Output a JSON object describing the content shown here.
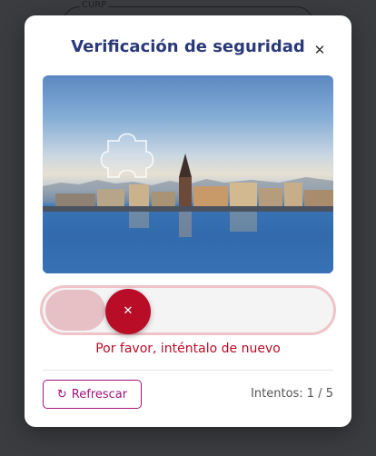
{
  "background": {
    "field_label": "CURP"
  },
  "captcha": {
    "title": "Verificación de seguridad",
    "close_icon": "close-icon",
    "slider_handle_icon": "close-icon",
    "error_message": "Por favor, inténtalo de nuevo",
    "refresh_label": "Refrescar",
    "refresh_icon": "refresh-icon",
    "attempts_label": "Intentos: 1 / 5",
    "colors": {
      "title": "#2a3a78",
      "accent": "#b80c27",
      "refresh": "#a1127a"
    }
  }
}
